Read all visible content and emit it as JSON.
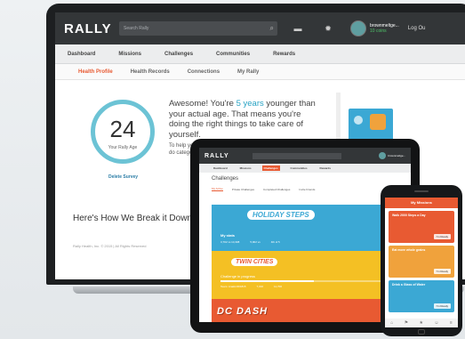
{
  "laptop": {
    "logo": "RALLY",
    "search_placeholder": "Search Rally",
    "user_name": "brownmeltge...",
    "user_coins": "10 coins",
    "logout": "Log Ou",
    "nav": [
      "Dashboard",
      "Missions",
      "Challenges",
      "Communities",
      "Rewards"
    ],
    "subnav": [
      "Health Profile",
      "Health Records",
      "Connections",
      "My Rally"
    ],
    "rally_age": "24",
    "rally_age_label": "Your Rally Age",
    "delete_label": "Delete Survey",
    "headline_pre": "Awesome! You're ",
    "headline_highlight": "5 years",
    "headline_post": " younger than your actual age. That means you're doing the right things to take care of yourself.",
    "detail": "To help you broken do categori individu",
    "breakdown": "Here's How We Break it Down",
    "footer": "Rally Health, Inc. © 2015 | All Rights Reserved"
  },
  "tablet": {
    "logo": "RALLY",
    "user_name": "brownmeltge...",
    "nav": [
      "Dashboard",
      "Missions",
      "Challenges",
      "Communities",
      "Rewards"
    ],
    "active_nav": "Challenges",
    "heading": "Challenges",
    "tabs": [
      "My Active",
      "Private Challenges",
      "Completed Challenges",
      "Invite Friends"
    ],
    "panel1": {
      "banner": "HOLIDAY STEPS",
      "stats_label": "My stats",
      "stats": [
        "3,702 vs 14,308",
        "5,902 vs",
        "4th of 5"
      ]
    },
    "panel2": {
      "banner": "TWIN CITIES",
      "progress": "Challenge in progress",
      "stats": [
        "Team: Anakin3D1815",
        "7,016",
        "11,700"
      ],
      "progress_fraction": 0.55
    },
    "panel3": {
      "banner": "DC DASH"
    }
  },
  "phone": {
    "header": "My Missions",
    "cards": [
      {
        "title": "Walk 2000 Steps a Day",
        "button": "I'm Ready",
        "color": "#e85a32"
      },
      {
        "title": "Eat more whole grains",
        "button": "I'm Ready",
        "color": "#f0a23c"
      },
      {
        "title": "Drink a Glass of Water",
        "button": "I'm Ready",
        "color": "#3ba8d4"
      }
    ],
    "tab_icons": [
      "home-icon",
      "flag-icon",
      "star-icon",
      "person-icon",
      "menu-icon"
    ]
  },
  "colors": {
    "brand_orange": "#e85a32",
    "teal": "#6cc3d5",
    "blue": "#3ba8d4",
    "yellow": "#f4c024"
  }
}
